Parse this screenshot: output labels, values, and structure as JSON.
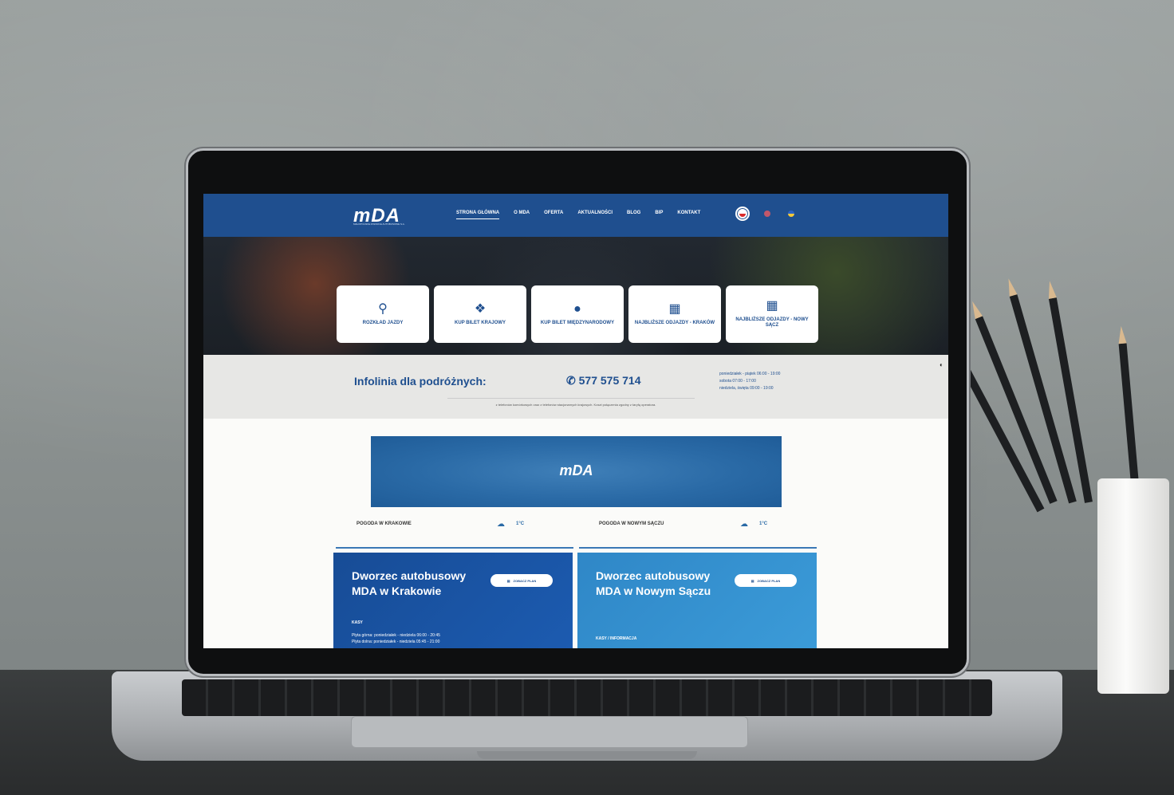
{
  "header": {
    "logo": "mDA",
    "logo_sub": "MAŁOPOLSKIE DWORCE AUTOBUSOWE S.A.",
    "nav": [
      "STRONA GŁÓWNA",
      "O MDA",
      "OFERTA",
      "AKTUALNOŚCI",
      "BLOG",
      "BIP",
      "KONTAKT"
    ]
  },
  "tiles": [
    {
      "label": "ROZKŁAD JAZDY",
      "icon": "search-icon"
    },
    {
      "label": "KUP BILET KRAJOWY",
      "icon": "ticket-icon"
    },
    {
      "label": "KUP BILET MIĘDZYNARODOWY",
      "icon": "globe-ticket-icon"
    },
    {
      "label": "NAJBLIŻSZE ODJAZDY - KRAKÓW",
      "icon": "calendar-clock-icon"
    },
    {
      "label": "NAJBLIŻSZE ODJAZDY - NOWY SĄCZ",
      "icon": "calendar-clock-icon"
    }
  ],
  "infoline": {
    "title": "Infolinia dla podróżnych:",
    "phone": "577 575 714",
    "hours": [
      "poniedziałek - piątek 06:00 - 19:00",
      "sobota 07:00 - 17:00",
      "niedziela, święta 09:00 - 19:00"
    ],
    "note": "z telefonów komórkowych oraz z telefonów stacjonarnych krajowych. Koszt połączenia zgodny z taryfą operatora."
  },
  "banner": {
    "logo": "mDA"
  },
  "weather": [
    {
      "label": "POGODA W KRAKOWIE",
      "temp": "1°C"
    },
    {
      "label": "POGODA W NOWYM SĄCZU",
      "temp": "1°C"
    }
  ],
  "stations": [
    {
      "title": "Dworzec autobusowy MDA w Krakowie",
      "button": "ZOBACZ PLAN",
      "sub": "KASY",
      "hours": [
        "Płyta górna: poniedziałek - niedziela 06:00 - 20:45",
        "Płyta dolna: poniedziałek - niedziela 05:45 - 21:00"
      ]
    },
    {
      "title": "Dworzec autobusowy MDA w Nowym Sączu",
      "button": "ZOBACZ PLAN",
      "sub": "KASY / INFORMACJA"
    }
  ],
  "colors": {
    "brand": "#1f4f8f",
    "accent": "#2a6aa6"
  }
}
